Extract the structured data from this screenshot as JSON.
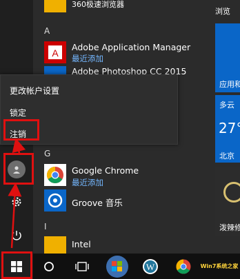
{
  "app_list": {
    "top_partial_app": "360极速浏览器",
    "section_a": "A",
    "adobe_am": {
      "name": "Adobe Application Manager",
      "sub": "最近添加"
    },
    "adobe_ps": {
      "name": "Adobe Photoshop CC 2015"
    },
    "section_g": "G",
    "chrome": {
      "name": "Google Chrome",
      "sub": "最近添加"
    },
    "groove": {
      "name": "Groove 音乐"
    },
    "section_i": "I",
    "intel": {
      "name": "Intel"
    }
  },
  "account_menu": {
    "items": [
      "更改帐户设置",
      "锁定",
      "注销"
    ]
  },
  "tiles": {
    "header": "浏览",
    "tile_app_label": "应用和",
    "weather_condition": "多云",
    "weather_temp": "27°",
    "weather_city": "北京",
    "bottom_tile_label": "泼辣修"
  },
  "taskbar": {
    "items": [
      "start-button",
      "cortana",
      "task-view",
      "windows-media",
      "wordpress",
      "chrome",
      "com"
    ]
  },
  "watermark": {
    "text": "Win7系统之家",
    "brand_color": "#e01010"
  },
  "colors": {
    "accent": "#0a66c8",
    "highlight": "#e01010",
    "link": "#74b7ff"
  }
}
